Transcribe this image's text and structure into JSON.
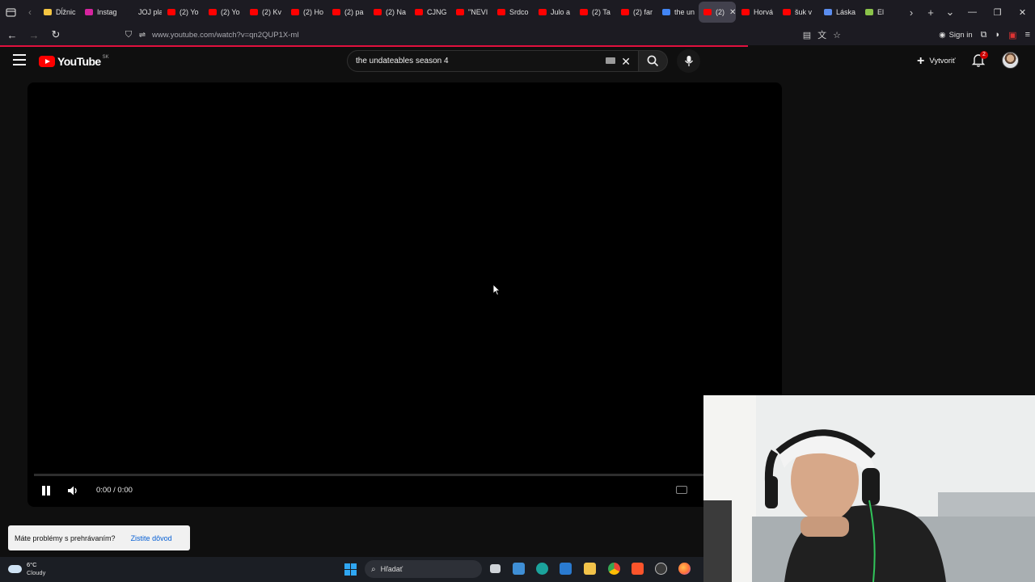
{
  "browser": {
    "tabs": [
      {
        "label": "Dĺžnic",
        "icon": "gdrive-icon",
        "color": "#f4c542",
        "active": false
      },
      {
        "label": "Instag",
        "icon": "instagram-icon",
        "color": "#d6249f",
        "active": false
      },
      {
        "label": "JOJ play",
        "icon": "joj-icon",
        "color": "#1c1b22",
        "active": false
      },
      {
        "label": "(2) Yo",
        "icon": "youtube-icon",
        "color": "#ff0000",
        "active": false
      },
      {
        "label": "(2) Yo",
        "icon": "youtube-icon",
        "color": "#ff0000",
        "active": false
      },
      {
        "label": "(2) Kv",
        "icon": "youtube-icon",
        "color": "#ff0000",
        "active": false
      },
      {
        "label": "(2) Ho",
        "icon": "youtube-icon",
        "color": "#ff0000",
        "active": false
      },
      {
        "label": "(2) pa",
        "icon": "youtube-icon",
        "color": "#ff0000",
        "active": false
      },
      {
        "label": "(2) Na",
        "icon": "youtube-icon",
        "color": "#ff0000",
        "active": false
      },
      {
        "label": "CJNG",
        "icon": "youtube-icon",
        "color": "#ff0000",
        "active": false
      },
      {
        "label": "\"NEVI",
        "icon": "youtube-icon",
        "color": "#ff0000",
        "active": false
      },
      {
        "label": "Srdco",
        "icon": "youtube-icon",
        "color": "#ff0000",
        "active": false
      },
      {
        "label": "Julo a",
        "icon": "youtube-icon",
        "color": "#ff0000",
        "active": false
      },
      {
        "label": "(2) Ta",
        "icon": "youtube-icon",
        "color": "#ff0000",
        "active": false
      },
      {
        "label": "(2) far",
        "icon": "youtube-icon",
        "color": "#ff0000",
        "active": false
      },
      {
        "label": "the un",
        "icon": "google-icon",
        "color": "#4285f4",
        "active": false
      },
      {
        "label": "(2)",
        "icon": "youtube-icon",
        "color": "#ff0000",
        "active": true
      },
      {
        "label": "Horvá",
        "icon": "youtube-icon",
        "color": "#ff0000",
        "active": false
      },
      {
        "label": "šuk v",
        "icon": "youtube-icon",
        "color": "#ff0000",
        "active": false
      },
      {
        "label": "Láska",
        "icon": "play-icon",
        "color": "#5b8def",
        "active": false
      },
      {
        "label": "El",
        "icon": "leaf-icon",
        "color": "#8bc34a",
        "active": false
      }
    ],
    "url": "www.youtube.com/watch?v=qn2QUP1X-mI",
    "sign_in_label": "Sign in"
  },
  "youtube": {
    "region": "SK",
    "logo_text": "YouTube",
    "search_query": "the undateables season 4",
    "create_label": "Vytvoriť",
    "notification_count": "2"
  },
  "player": {
    "time": "0:00 / 0:00",
    "progress": 0,
    "state": "playing"
  },
  "toast": {
    "message": "Máte problémy s prehrávaním?",
    "action": "Zistite dôvod"
  },
  "taskbar": {
    "temperature": "6°C",
    "condition": "Cloudy",
    "search_placeholder": "Hľadať"
  },
  "colors": {
    "youtube_red": "#ff0000",
    "load_bar": "#e0113e",
    "link_blue": "#065fd4"
  }
}
